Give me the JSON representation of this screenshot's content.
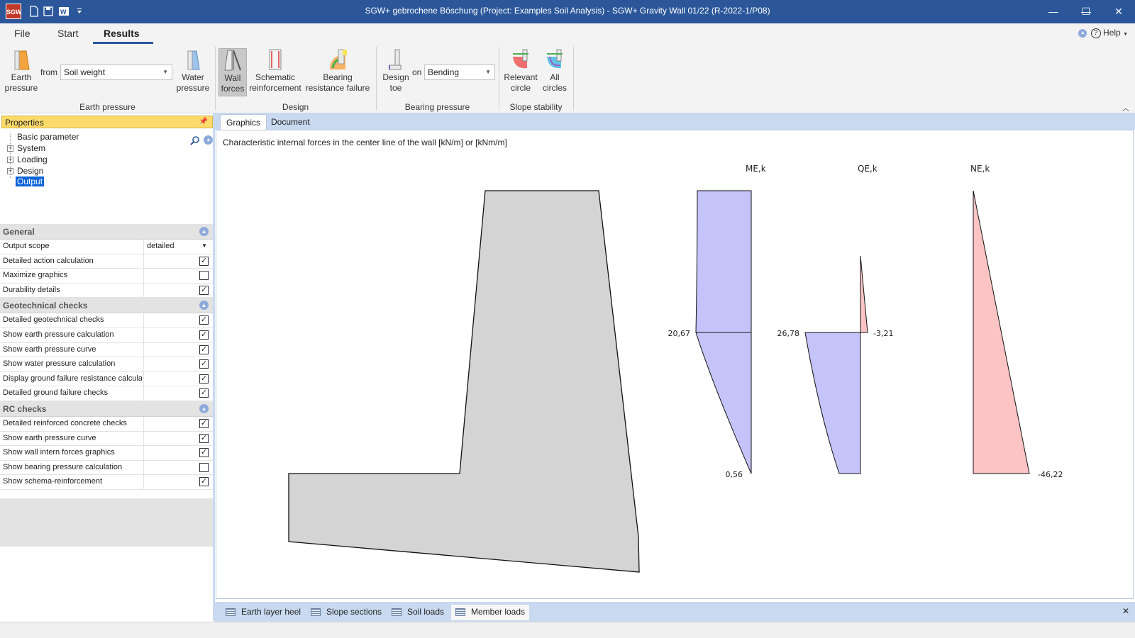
{
  "window": {
    "title": "SGW+ gebrochene Böschung (Project: Examples Soil Analysis) - SGW+ Gravity Wall 01/22 (R-2022-1/P08)",
    "app_logo": "SGW",
    "qat_icons": [
      "new-file-icon",
      "save-icon",
      "word-icon",
      "customize-arrow-icon"
    ],
    "controls": {
      "minimize": "—",
      "maximize": "☐",
      "close": "✕"
    }
  },
  "menu": {
    "tabs": [
      {
        "label": "File"
      },
      {
        "label": "Start"
      },
      {
        "label": "Results",
        "active": true
      }
    ],
    "help_label": "Help"
  },
  "ribbon": {
    "groups": [
      {
        "label": "Earth pressure"
      },
      {
        "label": "Design"
      },
      {
        "label": "Bearing pressure"
      },
      {
        "label": "Slope stability"
      }
    ],
    "earth_pressure": {
      "line1": "Earth",
      "line2": "pressure"
    },
    "from_label": "from",
    "from_value": "Soil weight",
    "water_pressure": {
      "line1": "Water",
      "line2": "pressure"
    },
    "wall_forces": {
      "line1": "Wall",
      "line2": "forces"
    },
    "schematic": {
      "line1": "Schematic",
      "line2": "reinforcement"
    },
    "bearing_failure": {
      "line1": "Bearing",
      "line2": "resistance failure"
    },
    "design_toe": {
      "line1": "Design",
      "line2": "toe"
    },
    "on_label": "on",
    "on_value": "Bending",
    "relevant_circle": {
      "line1": "Relevant",
      "line2": "circle"
    },
    "all_circles": {
      "line1": "All",
      "line2": "circles"
    }
  },
  "properties": {
    "header": "Properties",
    "tree": [
      {
        "label": "Basic parameter",
        "expandable": false
      },
      {
        "label": "System",
        "expandable": true
      },
      {
        "label": "Loading",
        "expandable": true
      },
      {
        "label": "Design",
        "expandable": true
      },
      {
        "label": "Output",
        "expandable": false,
        "selected": true
      }
    ],
    "sections": [
      {
        "title": "General",
        "rows": [
          {
            "label": "Output scope",
            "value": "detailed",
            "type": "dropdown"
          },
          {
            "label": "Detailed action calculation",
            "checked": true
          },
          {
            "label": "Maximize graphics",
            "checked": false
          },
          {
            "label": "Durability details",
            "checked": true
          }
        ]
      },
      {
        "title": "Geotechnical checks",
        "rows": [
          {
            "label": "Detailed geotechnical checks",
            "checked": true
          },
          {
            "label": "Show earth pressure calculation",
            "checked": true
          },
          {
            "label": "Show earth pressure curve",
            "checked": true
          },
          {
            "label": "Show water pressure calculation",
            "checked": true
          },
          {
            "label": "Display ground failure resistance calculatio",
            "checked": true
          },
          {
            "label": "Detailed ground failure checks",
            "checked": true
          }
        ]
      },
      {
        "title": "RC checks",
        "rows": [
          {
            "label": "Detailed reinforced concrete checks",
            "checked": true
          },
          {
            "label": "Show earth pressure curve",
            "checked": true
          },
          {
            "label": "Show wall intern forces graphics",
            "checked": true
          },
          {
            "label": "Show bearing pressure calculation",
            "checked": false
          },
          {
            "label": "Show schema-reinforcement",
            "checked": true
          }
        ]
      }
    ]
  },
  "content": {
    "tabs": [
      {
        "label": "Graphics",
        "active": true
      },
      {
        "label": "Document"
      }
    ],
    "caption": "Characteristic internal forces in the center line of the wall [kN/m] or [kNm/m]",
    "diagrams": {
      "me": {
        "title": "ME,k",
        "mid_value": "20,67",
        "bottom_value": "0,56"
      },
      "qe": {
        "title": "QE,k",
        "left_value": "26,78",
        "right_value": "-3,21"
      },
      "ne": {
        "title": "NE,k",
        "bottom_value": "-46,22"
      }
    },
    "colors": {
      "positive": "#c4c4fb",
      "negative": "#fcc4c4",
      "wall": "#d4d4d4"
    }
  },
  "bottom_tabs": [
    {
      "label": "Earth layer heel"
    },
    {
      "label": "Slope sections"
    },
    {
      "label": "Soil loads"
    },
    {
      "label": "Member loads",
      "active": true
    }
  ],
  "bottom_close": "✕"
}
